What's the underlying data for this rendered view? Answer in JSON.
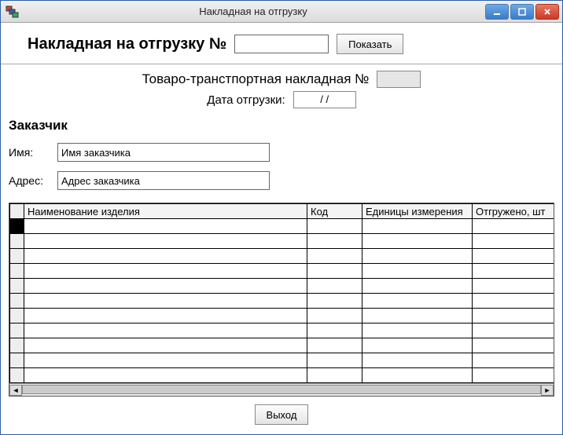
{
  "window": {
    "title": "Накладная на отгрузку"
  },
  "header": {
    "label": "Накладная на отгрузку №",
    "number_value": "",
    "show_button": "Показать"
  },
  "ttn": {
    "label": "Товаро-транстпортная накладная №",
    "number_value": "",
    "date_label": "Дата отгрузки:",
    "date_value": "/ /"
  },
  "customer": {
    "section": "Заказчик",
    "name_label": "Имя:",
    "name_value": "Имя заказчика",
    "address_label": "Адрес:",
    "address_value": "Адрес заказчика"
  },
  "grid": {
    "columns": [
      "Наименование изделия",
      "Код",
      "Единицы измерения",
      "Отгружено, шт"
    ],
    "rows": [
      [
        "",
        "",
        "",
        ""
      ],
      [
        "",
        "",
        "",
        ""
      ],
      [
        "",
        "",
        "",
        ""
      ],
      [
        "",
        "",
        "",
        ""
      ],
      [
        "",
        "",
        "",
        ""
      ],
      [
        "",
        "",
        "",
        ""
      ],
      [
        "",
        "",
        "",
        ""
      ],
      [
        "",
        "",
        "",
        ""
      ],
      [
        "",
        "",
        "",
        ""
      ],
      [
        "",
        "",
        "",
        ""
      ],
      [
        "",
        "",
        "",
        ""
      ]
    ]
  },
  "footer": {
    "exit_button": "Выход"
  },
  "icons": {
    "app": "db-icon"
  },
  "colors": {
    "accent": "#3a7bc8",
    "close": "#c83a2a"
  }
}
